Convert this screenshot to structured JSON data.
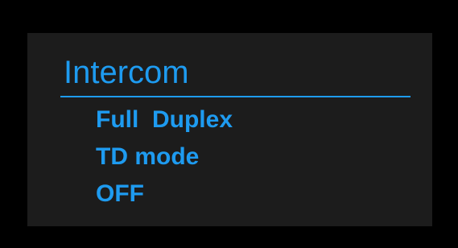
{
  "menu": {
    "title": "Intercom",
    "items": [
      {
        "label": "Full  Duplex"
      },
      {
        "label": "TD mode"
      },
      {
        "label": "OFF"
      }
    ]
  },
  "colors": {
    "background": "#000000",
    "panel": "#1c1c1c",
    "accent": "#1e9bf0"
  }
}
